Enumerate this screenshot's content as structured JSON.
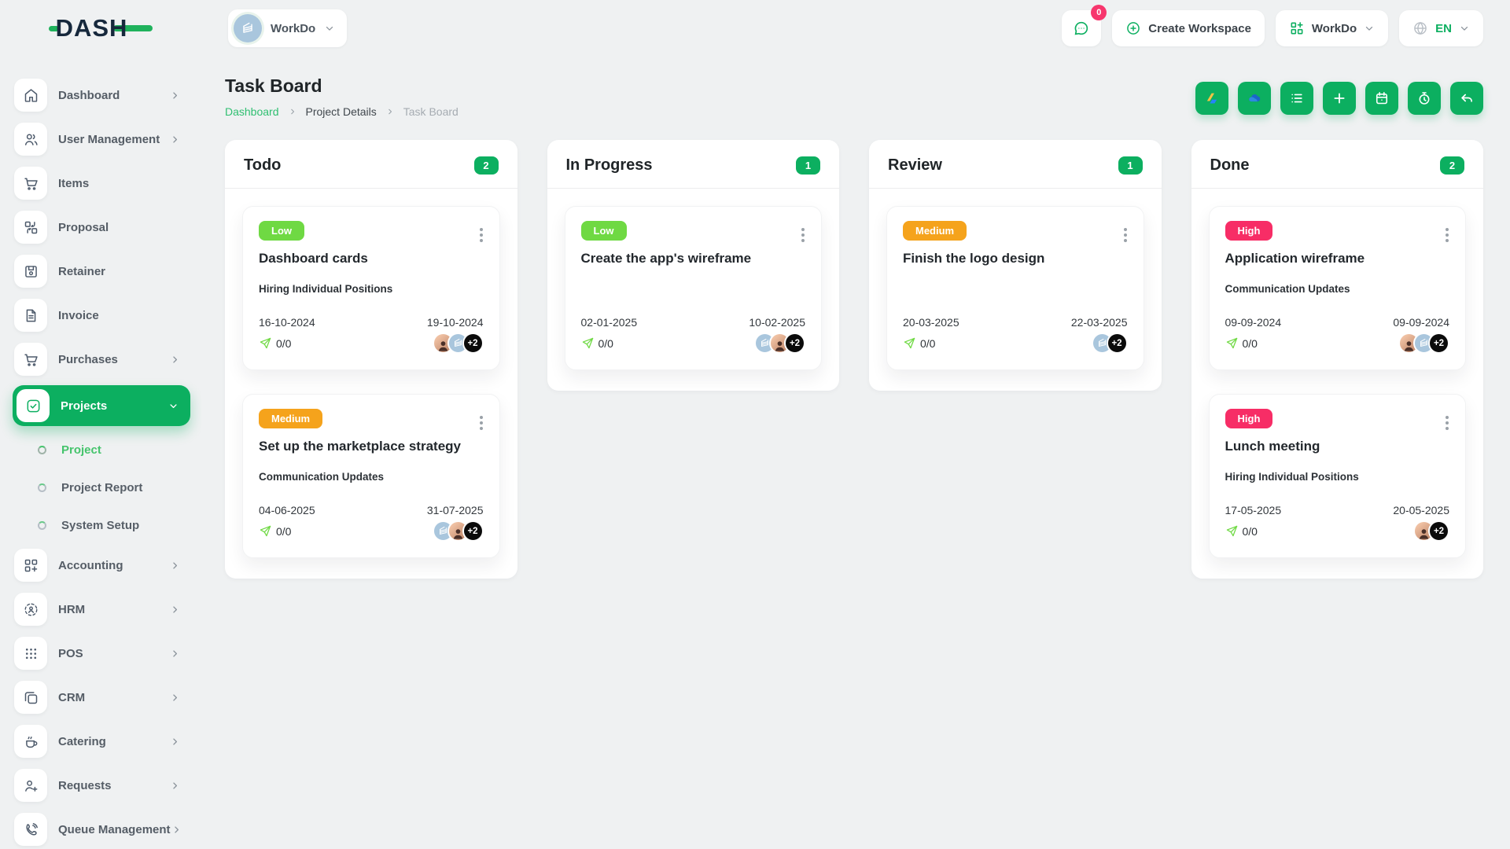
{
  "colors": {
    "primary_green": "#0caf60",
    "lime_green": "#6fd943",
    "priority_low": "#6fd943",
    "priority_medium": "#f5a31c",
    "priority_high": "#f72d66",
    "notification_pink": "#f7366d",
    "more_badge_black": "#0b0b0b"
  },
  "brand": {
    "name": "DASH"
  },
  "topbar": {
    "workspace": {
      "label": "WorkDo",
      "avatar_icon": "building-logo-icon"
    },
    "messages": {
      "badge": "0",
      "icon": "message-icon"
    },
    "create_workspace": {
      "label": "Create Workspace",
      "icon": "plus-circle-icon"
    },
    "app_menu": {
      "label": "WorkDo",
      "icon": "grid-plus-icon"
    },
    "language": {
      "label": "EN",
      "icon": "globe-icon"
    }
  },
  "sidebar": {
    "items": [
      {
        "label": "Dashboard",
        "icon": "home-icon",
        "chevron": "right"
      },
      {
        "label": "User Management",
        "icon": "users-icon",
        "chevron": "right"
      },
      {
        "label": "Items",
        "icon": "cart-icon"
      },
      {
        "label": "Proposal",
        "icon": "proposal-swap-icon"
      },
      {
        "label": "Retainer",
        "icon": "save-icon"
      },
      {
        "label": "Invoice",
        "icon": "file-text-icon"
      },
      {
        "label": "Purchases",
        "icon": "cart-icon",
        "chevron": "right"
      },
      {
        "label": "Projects",
        "icon": "check-square-icon",
        "chevron": "down",
        "active": true,
        "children": [
          {
            "label": "Project",
            "active": true
          },
          {
            "label": "Project Report"
          },
          {
            "label": "System Setup"
          }
        ]
      },
      {
        "label": "Accounting",
        "icon": "grid-plus-icon",
        "chevron": "right"
      },
      {
        "label": "HRM",
        "icon": "hrm-target-user-icon",
        "chevron": "right"
      },
      {
        "label": "POS",
        "icon": "dots-grid-icon",
        "chevron": "right"
      },
      {
        "label": "CRM",
        "icon": "copy-squares-icon",
        "chevron": "right"
      },
      {
        "label": "Catering",
        "icon": "coffee-icon",
        "chevron": "right"
      },
      {
        "label": "Requests",
        "icon": "user-plus-icon",
        "chevron": "right"
      },
      {
        "label": "Queue Management",
        "icon": "phone-call-icon",
        "chevron": "right"
      }
    ]
  },
  "page": {
    "title": "Task Board",
    "breadcrumb": [
      {
        "label": "Dashboard",
        "type": "link"
      },
      {
        "label": "Project Details",
        "type": "text"
      },
      {
        "label": "Task Board",
        "type": "current"
      }
    ],
    "toolbar": [
      {
        "name": "google-drive-button",
        "icon": "google-drive-icon"
      },
      {
        "name": "onedrive-button",
        "icon": "onedrive-icon"
      },
      {
        "name": "list-view-button",
        "icon": "list-icon"
      },
      {
        "name": "add-task-button",
        "icon": "plus-icon"
      },
      {
        "name": "calendar-button",
        "icon": "calendar-icon"
      },
      {
        "name": "timer-button",
        "icon": "timer-icon"
      },
      {
        "name": "back-button",
        "icon": "undo-icon"
      }
    ]
  },
  "board": {
    "columns": [
      {
        "name": "Todo",
        "count": "2",
        "cards": [
          {
            "priority": "Low",
            "priority_color": "#6fd943",
            "title": "Dashboard cards",
            "milestone": "Hiring Individual Positions",
            "start_date": "16-10-2024",
            "due_date": "19-10-2024",
            "progress": "0/0",
            "avatars": [
              "member-photo",
              "workspace-logo"
            ],
            "more_members": "+2"
          },
          {
            "priority": "Medium",
            "priority_color": "#f5a31c",
            "title": "Set up the marketplace strategy",
            "milestone": "Communication Updates",
            "start_date": "04-06-2025",
            "due_date": "31-07-2025",
            "progress": "0/0",
            "avatars": [
              "workspace-logo",
              "member-photo"
            ],
            "more_members": "+2"
          }
        ]
      },
      {
        "name": "In Progress",
        "count": "1",
        "cards": [
          {
            "priority": "Low",
            "priority_color": "#6fd943",
            "title": "Create the app's wireframe",
            "milestone": "",
            "start_date": "02-01-2025",
            "due_date": "10-02-2025",
            "progress": "0/0",
            "avatars": [
              "workspace-logo",
              "member-photo"
            ],
            "more_members": "+2"
          }
        ]
      },
      {
        "name": "Review",
        "count": "1",
        "cards": [
          {
            "priority": "Medium",
            "priority_color": "#f5a31c",
            "title": "Finish the logo design",
            "milestone": "",
            "start_date": "20-03-2025",
            "due_date": "22-03-2025",
            "progress": "0/0",
            "avatars": [
              "workspace-logo"
            ],
            "more_members": "+2"
          }
        ]
      },
      {
        "name": "Done",
        "count": "2",
        "cards": [
          {
            "priority": "High",
            "priority_color": "#f72d66",
            "title": "Application wireframe",
            "milestone": "Communication Updates",
            "start_date": "09-09-2024",
            "due_date": "09-09-2024",
            "progress": "0/0",
            "avatars": [
              "member-photo",
              "workspace-logo"
            ],
            "more_members": "+2"
          },
          {
            "priority": "High",
            "priority_color": "#f72d66",
            "title": "Lunch meeting",
            "milestone": "Hiring Individual Positions",
            "start_date": "17-05-2025",
            "due_date": "20-05-2025",
            "progress": "0/0",
            "avatars": [
              "member-photo"
            ],
            "more_members": "+2"
          }
        ]
      }
    ]
  }
}
